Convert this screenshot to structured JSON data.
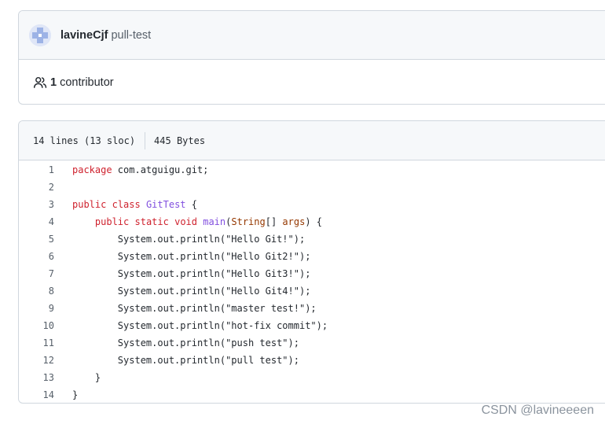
{
  "commit": {
    "author": "lavineCjf",
    "message": "pull-test"
  },
  "contributors": {
    "count": "1",
    "label": "contributor"
  },
  "file_info": {
    "lines": "14 lines (13 sloc)",
    "size": "445 Bytes"
  },
  "code_lines": [
    {
      "n": "1",
      "tokens": [
        {
          "t": "package",
          "c": "kw"
        },
        {
          "t": " com.atguigu.git;"
        }
      ]
    },
    {
      "n": "2",
      "tokens": []
    },
    {
      "n": "3",
      "tokens": [
        {
          "t": "public",
          "c": "kw"
        },
        {
          "t": " "
        },
        {
          "t": "class",
          "c": "kw"
        },
        {
          "t": " "
        },
        {
          "t": "GitTest",
          "c": "cl"
        },
        {
          "t": " {"
        }
      ]
    },
    {
      "n": "4",
      "tokens": [
        {
          "t": "    "
        },
        {
          "t": "public",
          "c": "kw"
        },
        {
          "t": " "
        },
        {
          "t": "static",
          "c": "kw"
        },
        {
          "t": " "
        },
        {
          "t": "void",
          "c": "kw"
        },
        {
          "t": " "
        },
        {
          "t": "main",
          "c": "fn"
        },
        {
          "t": "("
        },
        {
          "t": "String",
          "c": "ty"
        },
        {
          "t": "[] "
        },
        {
          "t": "args",
          "c": "ty"
        },
        {
          "t": ") {"
        }
      ]
    },
    {
      "n": "5",
      "tokens": [
        {
          "t": "        System.out.println(\"Hello Git!\");"
        }
      ]
    },
    {
      "n": "6",
      "tokens": [
        {
          "t": "        System.out.println(\"Hello Git2!\");"
        }
      ]
    },
    {
      "n": "7",
      "tokens": [
        {
          "t": "        System.out.println(\"Hello Git3!\");"
        }
      ]
    },
    {
      "n": "8",
      "tokens": [
        {
          "t": "        System.out.println(\"Hello Git4!\");"
        }
      ]
    },
    {
      "n": "9",
      "tokens": [
        {
          "t": "        System.out.println(\"master test!\");"
        }
      ]
    },
    {
      "n": "10",
      "tokens": [
        {
          "t": "        System.out.println(\"hot-fix commit\");"
        }
      ]
    },
    {
      "n": "11",
      "tokens": [
        {
          "t": "        System.out.println(\"push test\");"
        }
      ]
    },
    {
      "n": "12",
      "tokens": [
        {
          "t": "        System.out.println(\"pull test\");"
        }
      ]
    },
    {
      "n": "13",
      "tokens": [
        {
          "t": "    }"
        }
      ]
    },
    {
      "n": "14",
      "tokens": [
        {
          "t": "}"
        }
      ]
    }
  ],
  "watermark": "CSDN @lavineeeen"
}
